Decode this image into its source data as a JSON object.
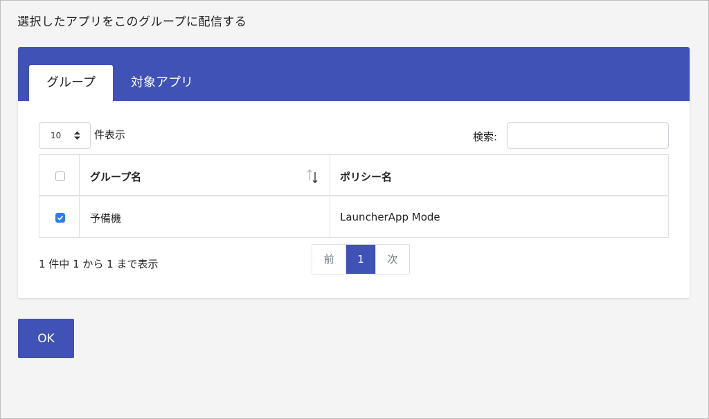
{
  "page": {
    "title": "選択したアプリをこのグループに配信する"
  },
  "tabs": [
    {
      "label": "グループ",
      "active": true
    },
    {
      "label": "対象アプリ",
      "active": false
    }
  ],
  "length_select": {
    "value": "10",
    "label": "件表示"
  },
  "search": {
    "label": "検索:",
    "value": "",
    "placeholder": ""
  },
  "table": {
    "columns": [
      "グループ名",
      "ポリシー名"
    ],
    "rows": [
      {
        "checked": true,
        "group": "予備機",
        "policy": "LauncherApp Mode"
      }
    ]
  },
  "info": "1 件中 1 から 1 まで表示",
  "pagination": {
    "prev": "前",
    "current": "1",
    "next": "次"
  },
  "ok_button": "OK",
  "colors": {
    "primary": "#4052b5",
    "checkbox": "#2f7cf6",
    "background": "#f4f4f4"
  }
}
